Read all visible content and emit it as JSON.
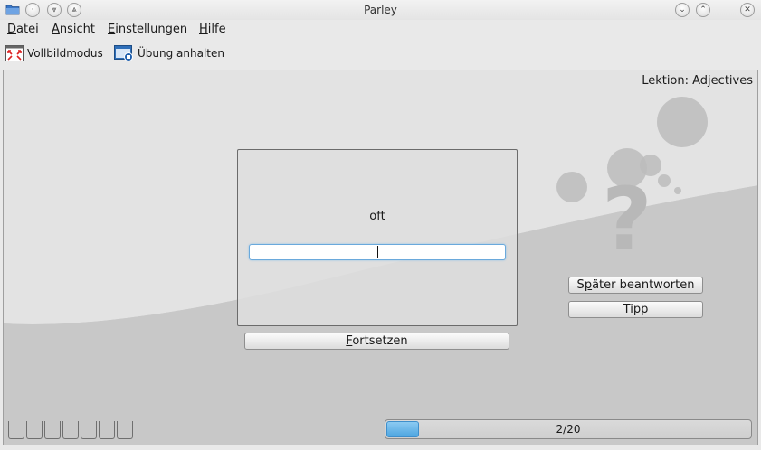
{
  "window": {
    "title": "Parley"
  },
  "menubar": {
    "items": [
      {
        "label": "Datei",
        "mnemonic": "D",
        "rest": "atei"
      },
      {
        "label": "Ansicht",
        "mnemonic": "A",
        "rest": "nsicht"
      },
      {
        "label": "Einstellungen",
        "mnemonic": "E",
        "rest": "instellungen"
      },
      {
        "label": "Hilfe",
        "mnemonic": "H",
        "rest": "ilfe"
      }
    ]
  },
  "toolbar": {
    "fullscreen_label": "Vollbildmodus",
    "stop_label": "Übung anhalten",
    "icons": {
      "fullscreen": "fullscreen-icon",
      "stop": "stop-practice-icon"
    }
  },
  "practice": {
    "lesson_label": "Lektion: Adjectives",
    "question": "oft",
    "answer_value": "",
    "continue_button": {
      "mnemonic": "F",
      "rest": "ortsetzen"
    },
    "later_button": {
      "before": "S",
      "mnemonic": "p",
      "rest": "äter beantworten"
    },
    "hint_button": {
      "mnemonic": "T",
      "rest": "ipp"
    },
    "progress": {
      "current": 2,
      "total": 20,
      "text": "2/20",
      "fraction": 0.1
    },
    "box_slots": 7
  },
  "colors": {
    "accent": "#4fa6e0",
    "background": "#c8c8c8",
    "card": "#dedede"
  }
}
